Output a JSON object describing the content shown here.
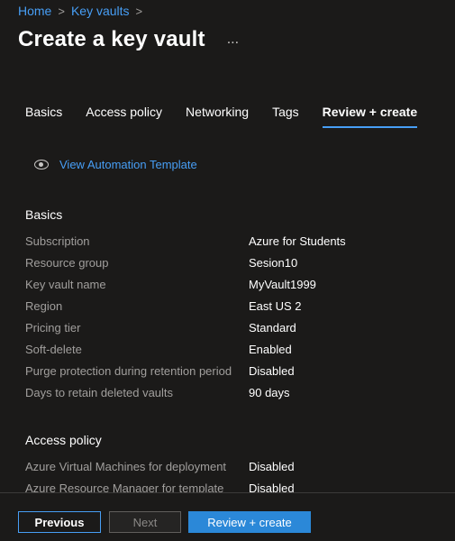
{
  "breadcrumb": {
    "home": "Home",
    "key_vaults": "Key vaults",
    "sep": ">"
  },
  "page_title": "Create a key vault",
  "more_label": "...",
  "tabs": [
    {
      "label": "Basics"
    },
    {
      "label": "Access policy"
    },
    {
      "label": "Networking"
    },
    {
      "label": "Tags"
    },
    {
      "label": "Review + create"
    }
  ],
  "active_tab": "Review + create",
  "automation_link": "View Automation Template",
  "basics": {
    "heading": "Basics",
    "rows": [
      {
        "k": "Subscription",
        "v": "Azure for Students"
      },
      {
        "k": "Resource group",
        "v": "Sesion10"
      },
      {
        "k": "Key vault name",
        "v": "MyVault1999"
      },
      {
        "k": "Region",
        "v": "East US 2"
      },
      {
        "k": "Pricing tier",
        "v": "Standard"
      },
      {
        "k": "Soft-delete",
        "v": "Enabled"
      },
      {
        "k": "Purge protection during retention period",
        "v": "Disabled"
      },
      {
        "k": "Days to retain deleted vaults",
        "v": "90 days"
      }
    ]
  },
  "access_policy": {
    "heading": "Access policy",
    "rows": [
      {
        "k": "Azure Virtual Machines for deployment",
        "v": "Disabled"
      },
      {
        "k": "Azure Resource Manager for template",
        "v": "Disabled"
      }
    ]
  },
  "footer": {
    "previous": "Previous",
    "next": "Next",
    "review": "Review + create"
  },
  "colors": {
    "background": "#1b1a19",
    "accent": "#479ef5",
    "primary_button": "#2b88d8",
    "muted_text": "#a19f9d"
  }
}
